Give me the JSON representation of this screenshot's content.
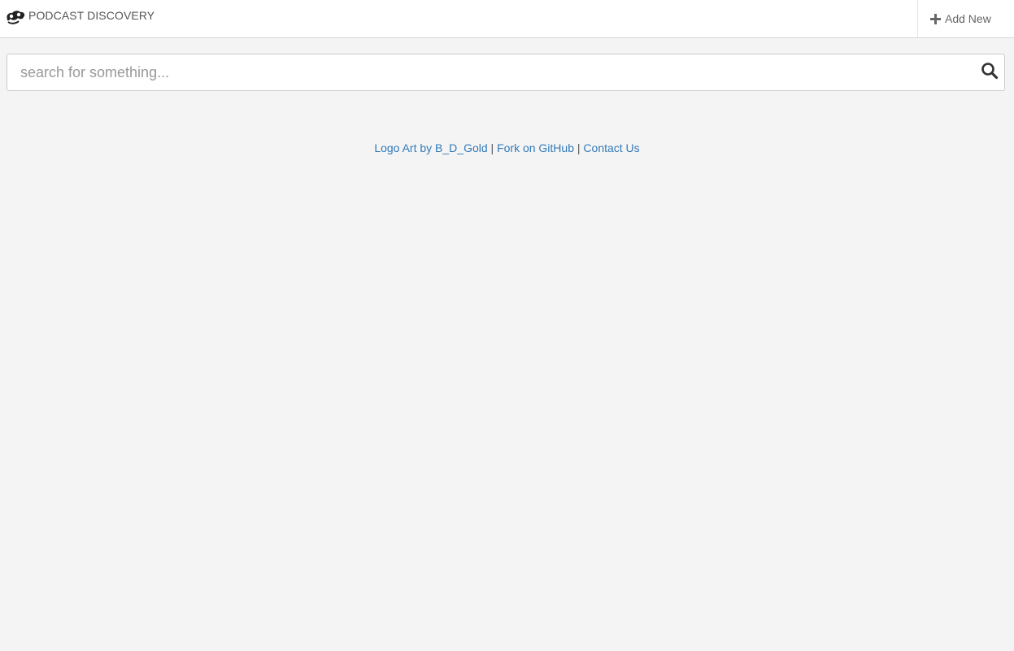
{
  "navbar": {
    "brand_title": "PODCAST DISCOVERY",
    "brand_logo_icon": "podcast-logo-icon",
    "add_new_label": "Add New",
    "add_new_icon": "plus-icon"
  },
  "search": {
    "placeholder": "search for something...",
    "value": "",
    "button_icon": "search-icon"
  },
  "footer": {
    "links": [
      {
        "label": "Logo Art by B_D_Gold"
      },
      {
        "label": "Fork on GitHub"
      },
      {
        "label": "Contact Us"
      }
    ],
    "separator": "|"
  },
  "colors": {
    "background": "#f4f4f4",
    "navbar": "#ffffff",
    "link": "#337ab7",
    "text": "#555555"
  }
}
